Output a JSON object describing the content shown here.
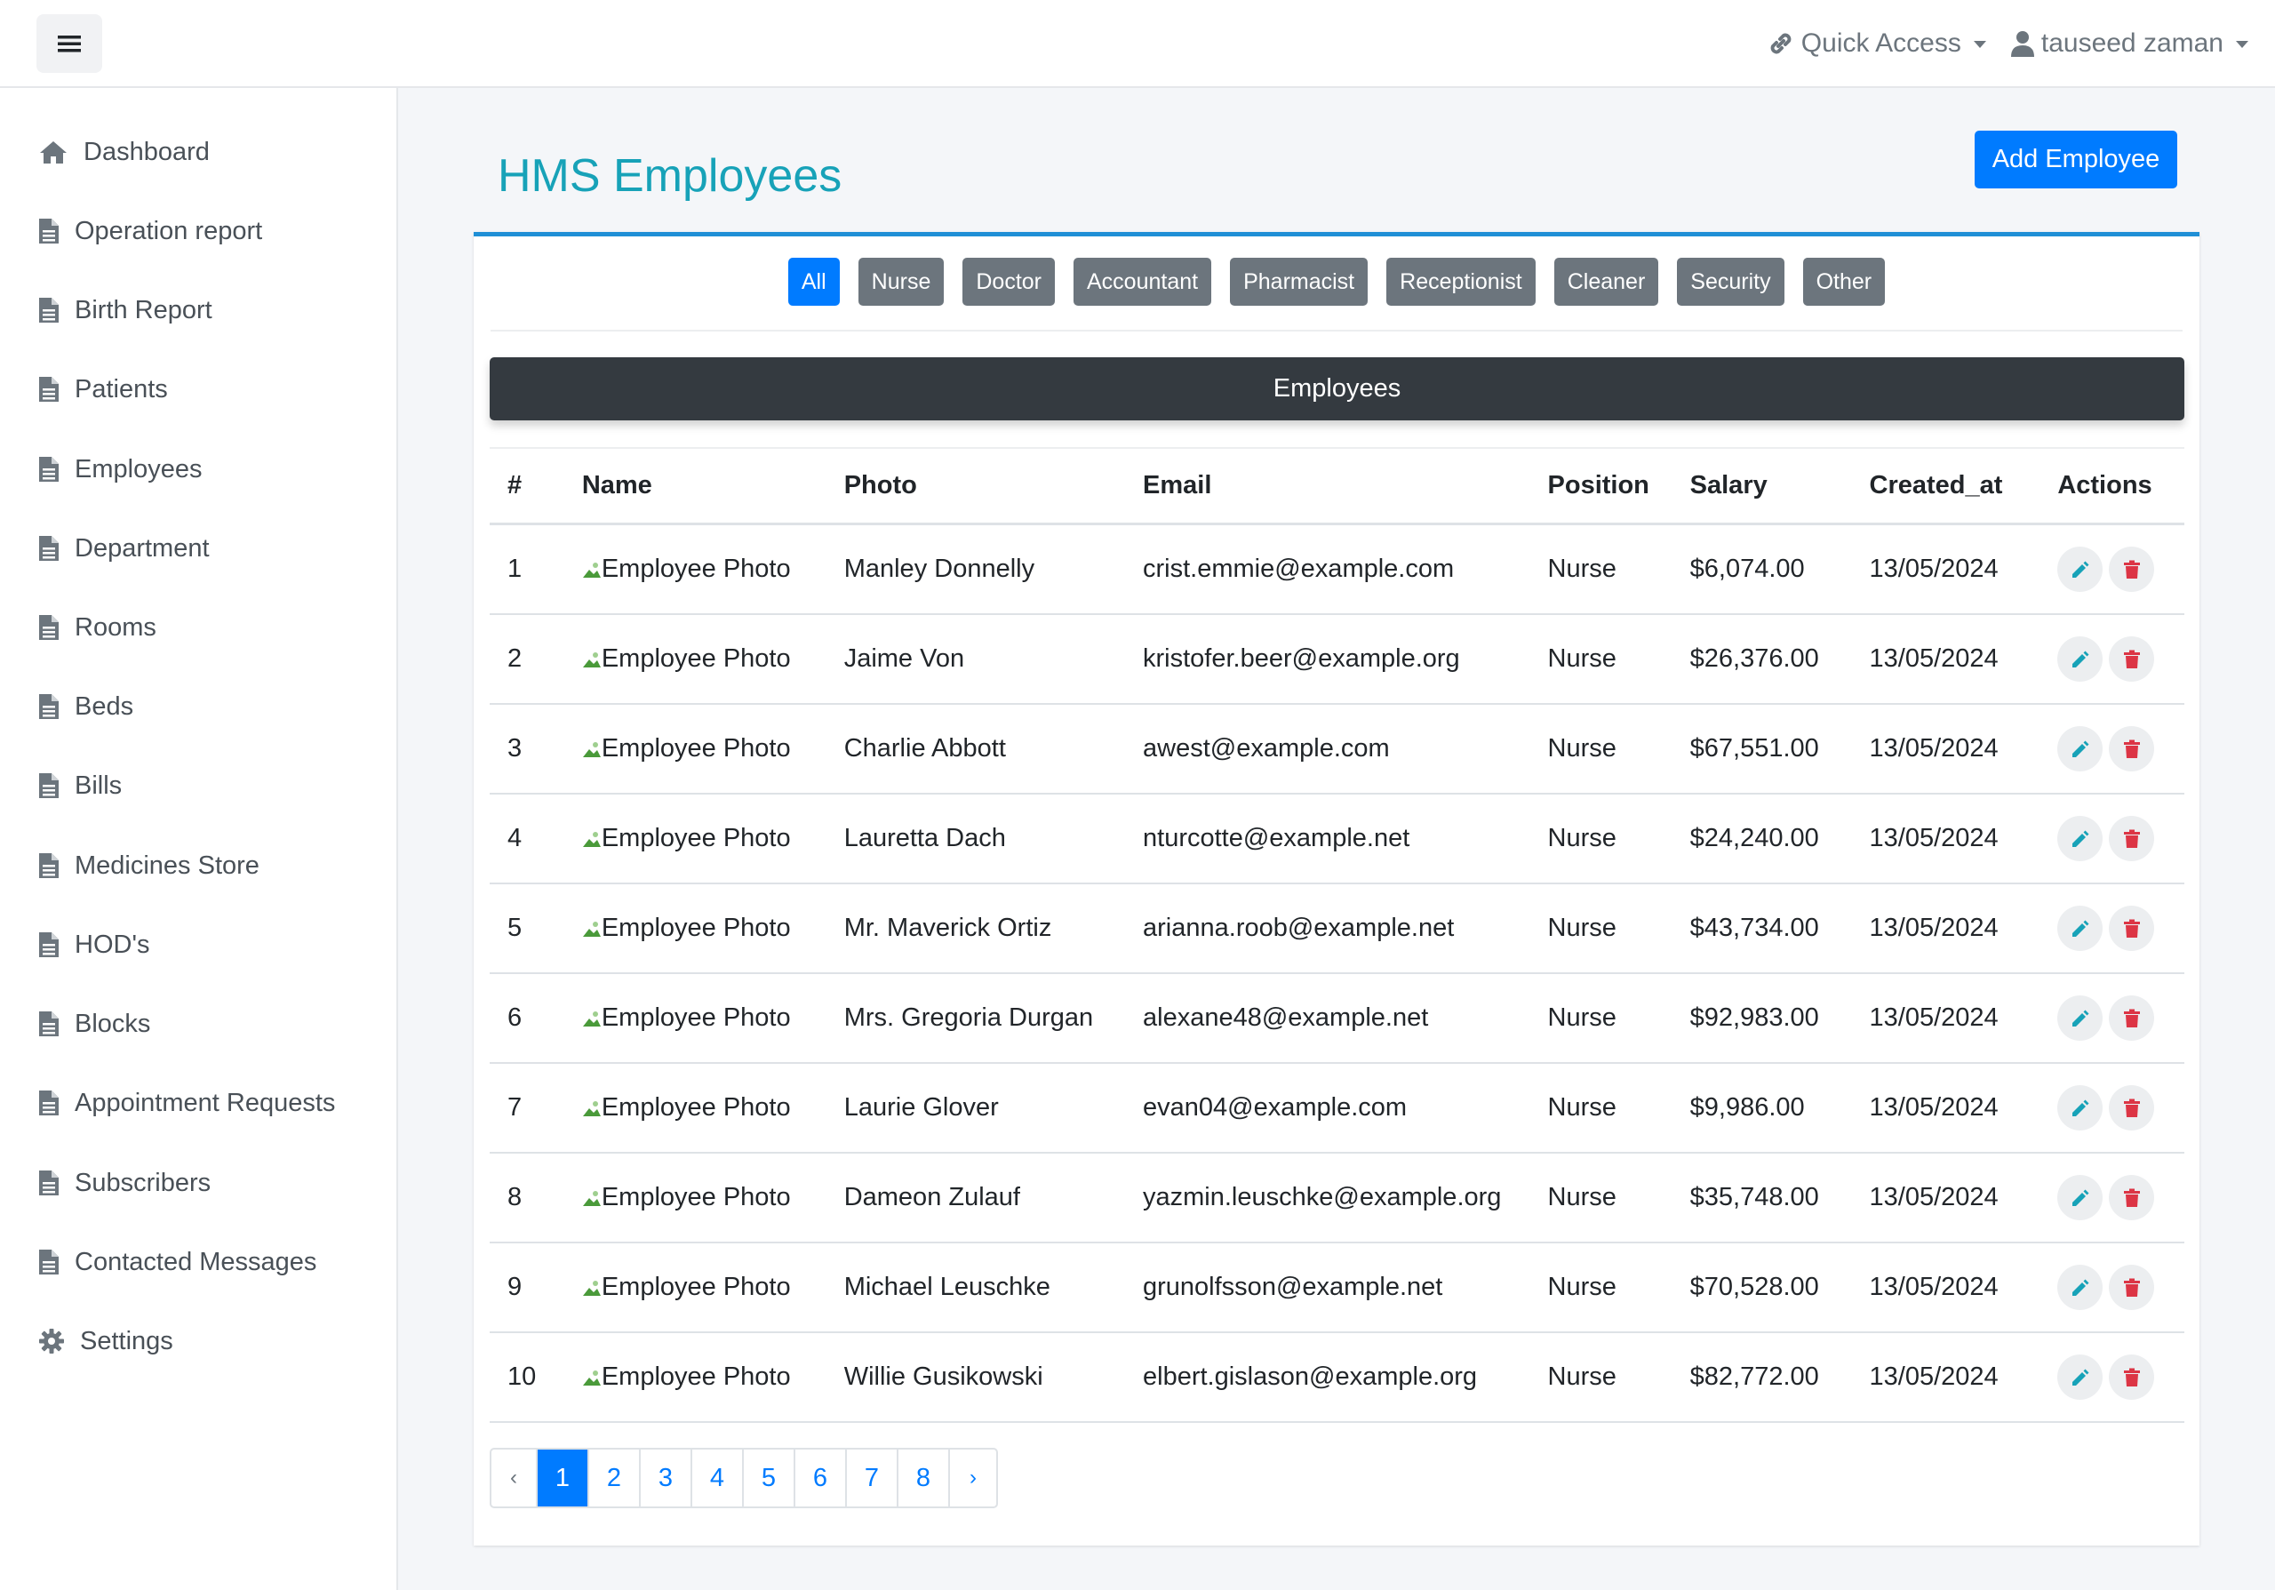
{
  "header": {
    "quick_access": "Quick Access",
    "user_name": "tauseed zaman"
  },
  "sidebar": {
    "items": [
      {
        "label": "Dashboard",
        "icon": "home-icon"
      },
      {
        "label": "Operation report",
        "icon": "document-icon"
      },
      {
        "label": "Birth Report",
        "icon": "document-icon"
      },
      {
        "label": "Patients",
        "icon": "document-icon"
      },
      {
        "label": "Employees",
        "icon": "document-icon"
      },
      {
        "label": "Department",
        "icon": "document-icon"
      },
      {
        "label": "Rooms",
        "icon": "document-icon"
      },
      {
        "label": "Beds",
        "icon": "document-icon"
      },
      {
        "label": "Bills",
        "icon": "document-icon"
      },
      {
        "label": "Medicines Store",
        "icon": "document-icon"
      },
      {
        "label": "HOD's",
        "icon": "document-icon"
      },
      {
        "label": "Blocks",
        "icon": "document-icon"
      },
      {
        "label": "Appointment Requests",
        "icon": "document-icon"
      },
      {
        "label": "Subscribers",
        "icon": "document-icon"
      },
      {
        "label": "Contacted Messages",
        "icon": "document-icon"
      },
      {
        "label": "Settings",
        "icon": "gear-icon"
      }
    ]
  },
  "main": {
    "title": "HMS Employees",
    "add_button": "Add Employee",
    "filters": [
      "All",
      "Nurse",
      "Doctor",
      "Accountant",
      "Pharmacist",
      "Receptionist",
      "Cleaner",
      "Security",
      "Other"
    ],
    "active_filter": "All",
    "table_title": "Employees",
    "columns": [
      "#",
      "Name",
      "Photo",
      "Email",
      "Position",
      "Salary",
      "Created_at",
      "Actions"
    ],
    "rows": [
      {
        "num": "1",
        "photo_alt": "Employee Photo",
        "name": "Manley Donnelly",
        "email": "crist.emmie@example.com",
        "position": "Nurse",
        "salary": "$6,074.00",
        "created": "13/05/2024"
      },
      {
        "num": "2",
        "photo_alt": "Employee Photo",
        "name": "Jaime Von",
        "email": "kristofer.beer@example.org",
        "position": "Nurse",
        "salary": "$26,376.00",
        "created": "13/05/2024"
      },
      {
        "num": "3",
        "photo_alt": "Employee Photo",
        "name": "Charlie Abbott",
        "email": "awest@example.com",
        "position": "Nurse",
        "salary": "$67,551.00",
        "created": "13/05/2024"
      },
      {
        "num": "4",
        "photo_alt": "Employee Photo",
        "name": "Lauretta Dach",
        "email": "nturcotte@example.net",
        "position": "Nurse",
        "salary": "$24,240.00",
        "created": "13/05/2024"
      },
      {
        "num": "5",
        "photo_alt": "Employee Photo",
        "name": "Mr. Maverick Ortiz",
        "email": "arianna.roob@example.net",
        "position": "Nurse",
        "salary": "$43,734.00",
        "created": "13/05/2024"
      },
      {
        "num": "6",
        "photo_alt": "Employee Photo",
        "name": "Mrs. Gregoria Durgan",
        "email": "alexane48@example.net",
        "position": "Nurse",
        "salary": "$92,983.00",
        "created": "13/05/2024"
      },
      {
        "num": "7",
        "photo_alt": "Employee Photo",
        "name": "Laurie Glover",
        "email": "evan04@example.com",
        "position": "Nurse",
        "salary": "$9,986.00",
        "created": "13/05/2024"
      },
      {
        "num": "8",
        "photo_alt": "Employee Photo",
        "name": "Dameon Zulauf",
        "email": "yazmin.leuschke@example.org",
        "position": "Nurse",
        "salary": "$35,748.00",
        "created": "13/05/2024"
      },
      {
        "num": "9",
        "photo_alt": "Employee Photo",
        "name": "Michael Leuschke",
        "email": "grunolfsson@example.net",
        "position": "Nurse",
        "salary": "$70,528.00",
        "created": "13/05/2024"
      },
      {
        "num": "10",
        "photo_alt": "Employee Photo",
        "name": "Willie Gusikowski",
        "email": "elbert.gislason@example.org",
        "position": "Nurse",
        "salary": "$82,772.00",
        "created": "13/05/2024"
      }
    ],
    "pagination": {
      "prev": "‹",
      "pages": [
        "1",
        "2",
        "3",
        "4",
        "5",
        "6",
        "7",
        "8"
      ],
      "active": "1",
      "next": "›"
    }
  },
  "colors": {
    "title": "#17a2b8",
    "primary": "#007bff",
    "secondary": "#6c757d",
    "banner": "#343a40",
    "edit": "#17a2b8",
    "delete": "#dc3545"
  }
}
